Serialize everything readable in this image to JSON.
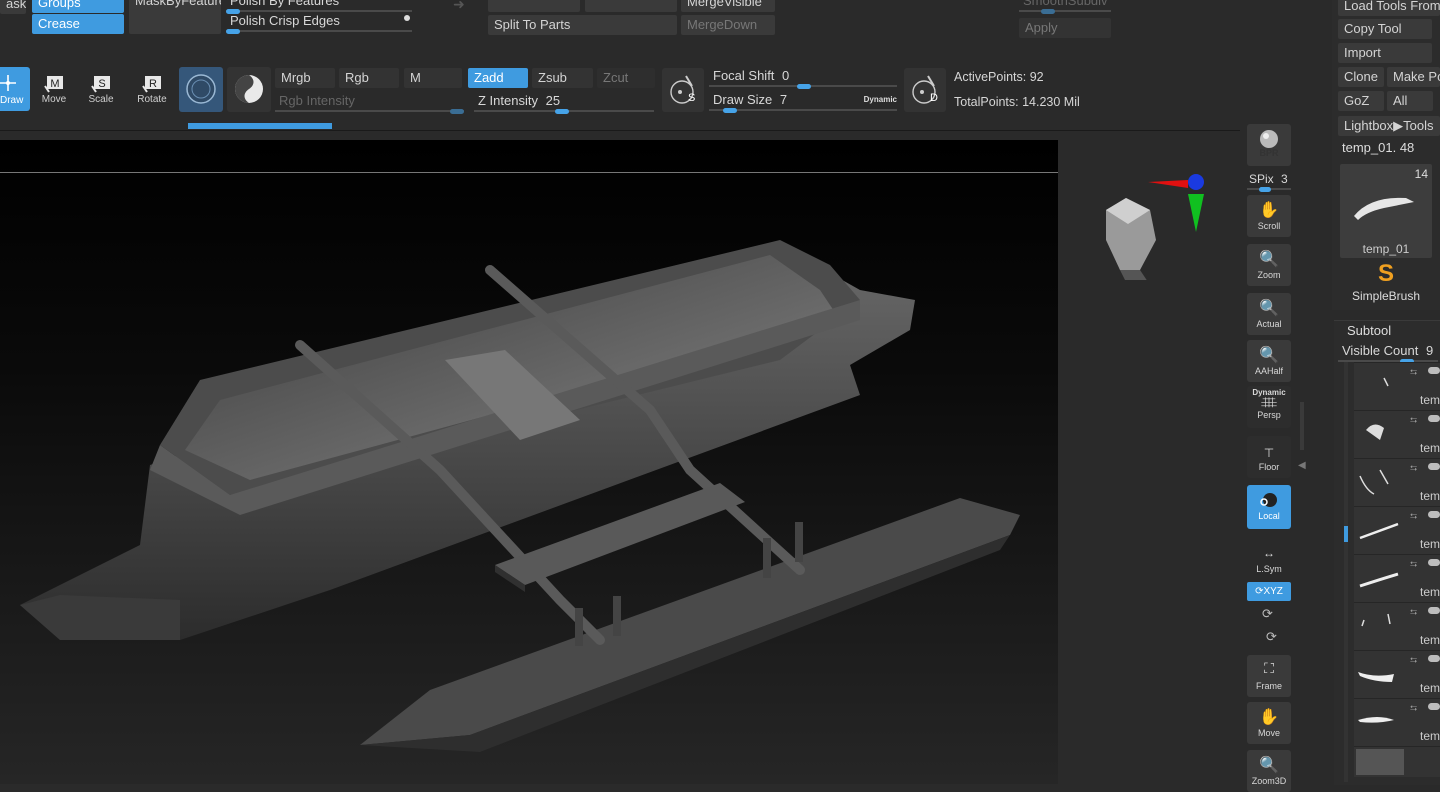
{
  "row1": {
    "mask_label": "ask",
    "groups_label": "Groups",
    "crease_label": "Crease",
    "mask_by_feature_label": "MaskByFeature",
    "polish_by_features_label": "Polish By Features",
    "polish_crisp_edges_label": "Polish Crisp Edges",
    "split_to_parts_label": "Split To Parts",
    "merge_visible_label": "MergeVisible",
    "merge_down_label": "MergeDown",
    "smooth_subdiv_label": "SmoothSubdiv",
    "apply_label": "Apply"
  },
  "toolbar": {
    "draw_label": "Draw",
    "move_label": "Move",
    "scale_label": "Scale",
    "rotate_label": "Rotate",
    "mrgb_label": "Mrgb",
    "rgb_label": "Rgb",
    "m_label": "M",
    "rgb_intensity_label": "Rgb Intensity",
    "zadd_label": "Zadd",
    "zsub_label": "Zsub",
    "zcut_label": "Zcut",
    "z_intensity_label": "Z Intensity",
    "z_intensity_value": "25",
    "z_intensity_level": 0.25,
    "focal_shift_label": "Focal Shift",
    "focal_shift_value": "0",
    "draw_size_label": "Draw Size",
    "draw_size_value": "7",
    "dynamic_label": "Dynamic",
    "s_letter": "S",
    "d_letter": "D",
    "active_points": "ActivePoints: 92",
    "total_points": "TotalPoints: 14.230 Mil"
  },
  "right_shelf": {
    "bpr_label": "BPR",
    "spix_label": "SPix",
    "spix_value": "3",
    "scroll_label": "Scroll",
    "zoom_label": "Zoom",
    "actual_label": "Actual",
    "aahalf_label": "AAHalf",
    "persp_label": "Persp",
    "persp_dynamic": "Dynamic",
    "floor_label": "Floor",
    "local_label": "Local",
    "lsym_label": "L.Sym",
    "xyz_label": "XYZ",
    "frame_label": "Frame",
    "move_label": "Move",
    "zoom3d_label": "Zoom3D"
  },
  "tool_panel": {
    "load_tools_label": "Load Tools From",
    "copy_tool_label": "Copy Tool",
    "import_label": "Import",
    "clone_label": "Clone",
    "make_poly_label": "Make Po",
    "goz_label": "GoZ",
    "all_label": "All",
    "lightbox_tools_label": "Lightbox▶Tools",
    "current_tool": "temp_01. 48",
    "thumb_count": "14",
    "thumb_name": "temp_01",
    "simplebrush_label": "SimpleBrush"
  },
  "subtool": {
    "title": "Subtool",
    "visible_count_label": "Visible Count",
    "visible_count_value": "9",
    "items": [
      {
        "name": "tem"
      },
      {
        "name": "tem"
      },
      {
        "name": "tem"
      },
      {
        "name": "tem"
      },
      {
        "name": "tem"
      },
      {
        "name": "tem"
      },
      {
        "name": "tem"
      },
      {
        "name": "tem"
      }
    ]
  },
  "colors": {
    "accent": "#3f9be0",
    "panel": "#2a2a2a",
    "button": "#3a3a3a",
    "canvas": "#050505"
  }
}
